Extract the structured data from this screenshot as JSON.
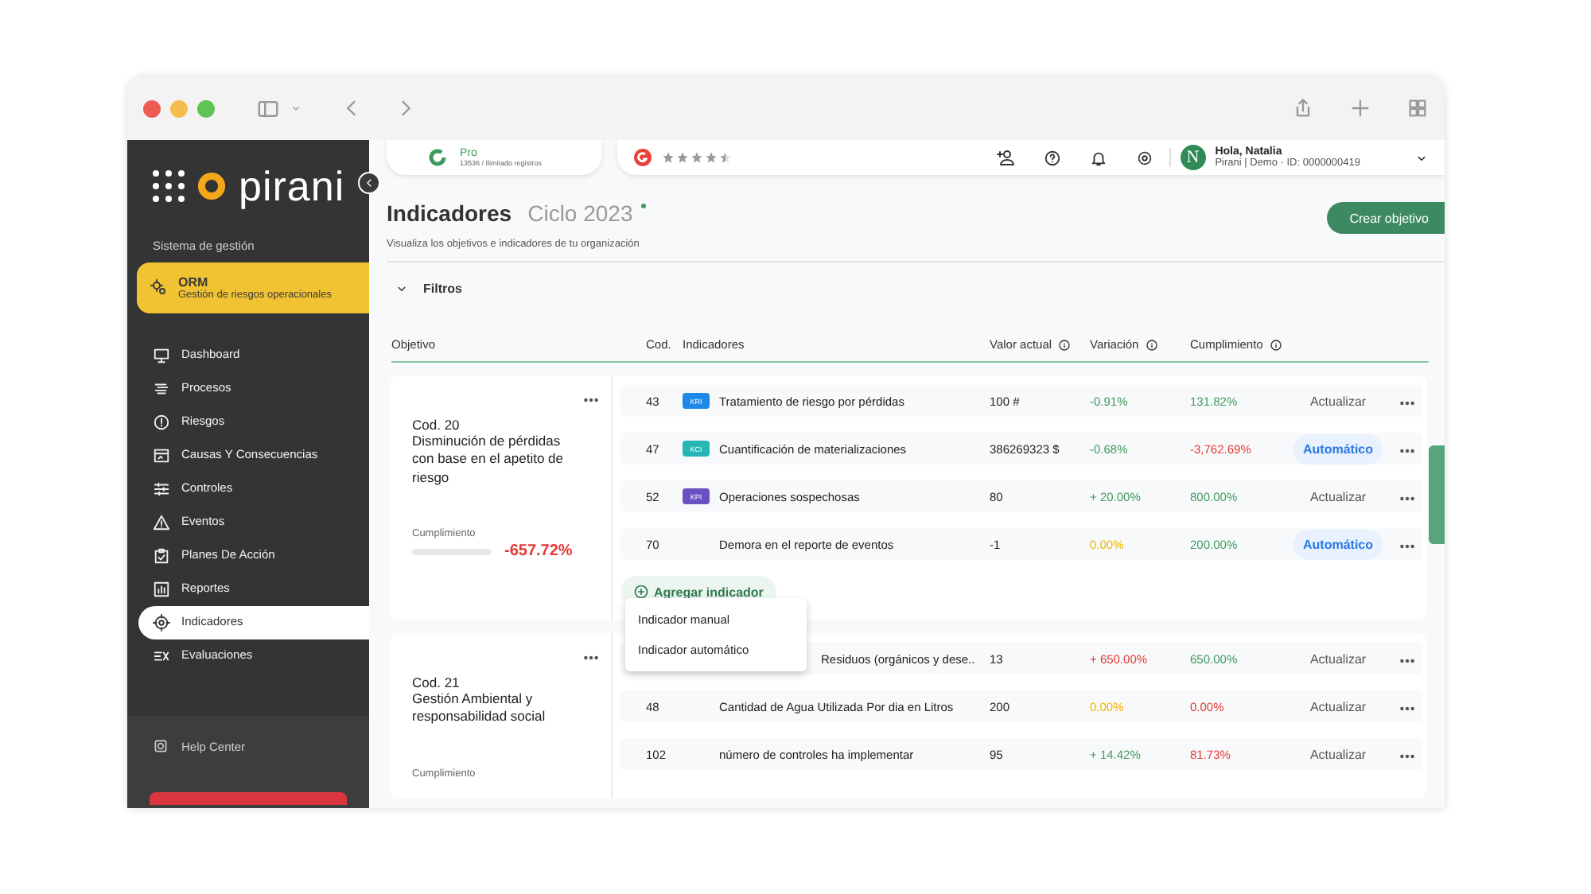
{
  "plan": {
    "name": "Pro",
    "detail": "13536 / Ilimitado registros"
  },
  "rating": {
    "stars": 4.5
  },
  "user": {
    "greeting": "Hola, Natalia",
    "initial": "N",
    "account": "Pirani | Demo · ID: 0000000419"
  },
  "sidebar": {
    "brand": "pirani",
    "section": "Sistema de gestión",
    "module": {
      "name": "ORM",
      "description": "Gestión de riesgos operacionales"
    },
    "items": [
      {
        "label": "Dashboard",
        "selected": false
      },
      {
        "label": "Procesos",
        "selected": false
      },
      {
        "label": "Riesgos",
        "selected": false
      },
      {
        "label": "Causas Y Consecuencias",
        "selected": false
      },
      {
        "label": "Controles",
        "selected": false
      },
      {
        "label": "Eventos",
        "selected": false
      },
      {
        "label": "Planes De Acción",
        "selected": false
      },
      {
        "label": "Reportes",
        "selected": false
      },
      {
        "label": "Indicadores",
        "selected": true
      },
      {
        "label": "Evaluaciones",
        "selected": false
      }
    ],
    "help": "Help Center"
  },
  "page": {
    "title": "Indicadores",
    "cycle": "Ciclo 2023",
    "subtitle": "Visualiza los objetivos e indicadores de tu organización",
    "create_button": "Crear objetivo",
    "filters": "Filtros"
  },
  "table": {
    "columns": [
      "Objetivo",
      "Cod.",
      "Indicadores",
      "Valor actual",
      "Variación",
      "Cumplimiento"
    ],
    "objectives": [
      {
        "code": "Cod. 20",
        "title": "Disminución de pérdidas con base en el apetito de riesgo",
        "progress_label": "Cumplimiento",
        "level": 0,
        "progress": {
          "text": "-657.72%",
          "color": "#e53935"
        },
        "add_button": "Agregar indicador",
        "rows": [
          {
            "cod": "43",
            "badge": {
              "label": "KRI",
              "color": "#1e88e5"
            },
            "name": "Tratamiento de riesgo por pérdidas",
            "value": "100 #",
            "variation": {
              "text": "-0.91%",
              "color": "#3d9a5f"
            },
            "compliance": {
              "text": "131.82%",
              "color": "#3d9a5f"
            },
            "action": {
              "kind": "update",
              "label": "Actualizar"
            }
          },
          {
            "cod": "47",
            "badge": {
              "label": "KCI",
              "color": "#26b6b6"
            },
            "name": "Cuantificación de materializaciones",
            "value": "386269323 $",
            "variation": {
              "text": "-0.68%",
              "color": "#3d9a5f"
            },
            "compliance": {
              "text": "-3,762.69%",
              "color": "#e53935"
            },
            "action": {
              "kind": "auto",
              "label": "Automático"
            }
          },
          {
            "cod": "52",
            "badge": {
              "label": "KPI",
              "color": "#6a4fc0"
            },
            "name": "Operaciones sospechosas",
            "value": "80",
            "variation": {
              "text": "+ 20.00%",
              "color": "#3d9a5f"
            },
            "compliance": {
              "text": "800.00%",
              "color": "#3d9a5f"
            },
            "action": {
              "kind": "update",
              "label": "Actualizar"
            }
          },
          {
            "cod": "70",
            "name": "Demora en el reporte de eventos",
            "value": "-1",
            "variation": {
              "text": "0.00%",
              "color": "#f2b300"
            },
            "compliance": {
              "text": "200.00%",
              "color": "#3d9a5f"
            },
            "action": {
              "kind": "auto",
              "label": "Automático"
            }
          }
        ],
        "menu": [
          "Indicador manual",
          "Indicador automático"
        ]
      },
      {
        "code": "Cod. 21",
        "title": "Gestión Ambiental y responsabilidad social",
        "progress_label": "Cumplimiento",
        "rows": [
          {
            "name": "Residuos (orgánicos y dese..",
            "value": "13",
            "variation": {
              "text": "+ 650.00%",
              "color": "#e53935"
            },
            "compliance": {
              "text": "650.00%",
              "color": "#3d9a5f"
            },
            "action": {
              "kind": "update",
              "label": "Actualizar"
            }
          },
          {
            "cod": "48",
            "name": "Cantidad de Agua Utilizada Por dia en Litros",
            "value": "200",
            "variation": {
              "text": "0.00%",
              "color": "#f2b300"
            },
            "compliance": {
              "text": "0.00%",
              "color": "#e53935"
            },
            "action": {
              "kind": "update",
              "label": "Actualizar"
            }
          },
          {
            "cod": "102",
            "name": "número de controles ha implementar",
            "value": "95",
            "variation": {
              "text": "+ 14.42%",
              "color": "#3d9a5f"
            },
            "compliance": {
              "text": "81.73%",
              "color": "#e53935"
            },
            "action": {
              "kind": "update",
              "label": "Actualizar"
            }
          }
        ]
      }
    ]
  }
}
